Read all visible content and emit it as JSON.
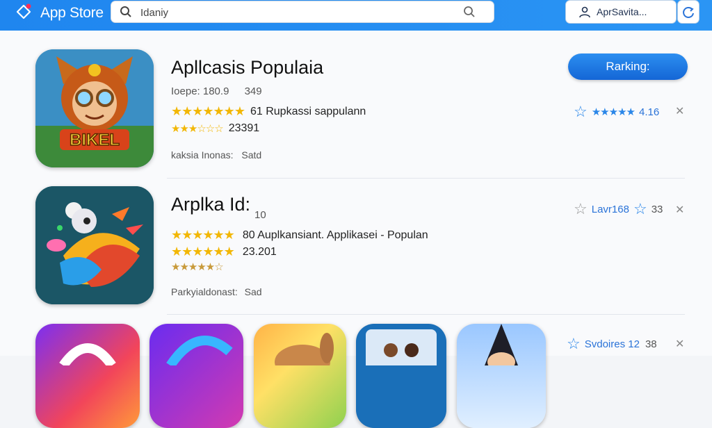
{
  "header": {
    "brand": "App Store",
    "search_value": "Idaniy",
    "account_label": "AprSavita..."
  },
  "apps": [
    {
      "title": "Apllcasis Populaia",
      "meta_a": "Ioepe: 180.9",
      "meta_b": "349",
      "line1": "61 Rupkassi sappulann",
      "line2": "23391",
      "developer": "kaksia Inonas:",
      "developer_suffix": "Satd",
      "rating_value": "4.16",
      "icon_text": "BIKEL"
    },
    {
      "title": "Arplka Id:",
      "meta_a": "10",
      "line1": "80 Auplkansiant. Applikasei - Populan",
      "line2": "23.201",
      "developer": "Parkyialdonast:",
      "developer_suffix": "Sad",
      "rating_a": "Lavr168",
      "rating_b": "33"
    }
  ],
  "ranking_button": "Rarking:",
  "row3_rating": "Svdoires 12",
  "row3_count": "38",
  "colors": {
    "accent": "#1f86ef",
    "star": "#f2b705",
    "star_blue": "#2a86e8"
  }
}
